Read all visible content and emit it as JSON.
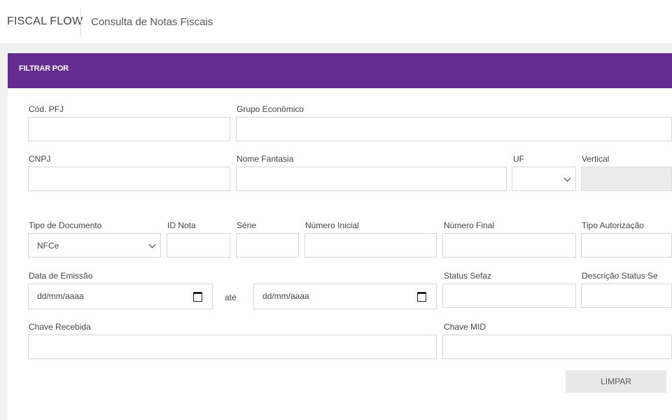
{
  "header": {
    "brand": "FISCAL FLOW",
    "page_title": "Consulta de Notas Fiscais"
  },
  "filter": {
    "title": "FILTRAR POR",
    "labels": {
      "cod_pfj": "Cód. PFJ",
      "grupo_economico": "Grupo Econômico",
      "cnpj": "CNPJ",
      "nome_fantasia": "Nome Fantasia",
      "uf": "UF",
      "vertical": "Vertical",
      "tipo_documento": "Tipo de Documento",
      "id_nota": "ID Nota",
      "serie": "Série",
      "numero_inicial": "Número Inicial",
      "numero_final": "Número Final",
      "tipo_autorizacao": "Tipo Autorização",
      "data_emissao": "Data de Emissão",
      "status_sefaz": "Status Sefaz",
      "descricao_status": "Descrição Status Se",
      "chave_recebida": "Chave Recebida",
      "chave_mid": "Chave MID"
    },
    "values": {
      "tipo_documento": "NFCe",
      "date_start_placeholder": "dd/mm/aaaa",
      "date_end_placeholder": "dd/mm/aaaa",
      "ate": "até"
    },
    "buttons": {
      "clear": "LIMPAR"
    }
  }
}
